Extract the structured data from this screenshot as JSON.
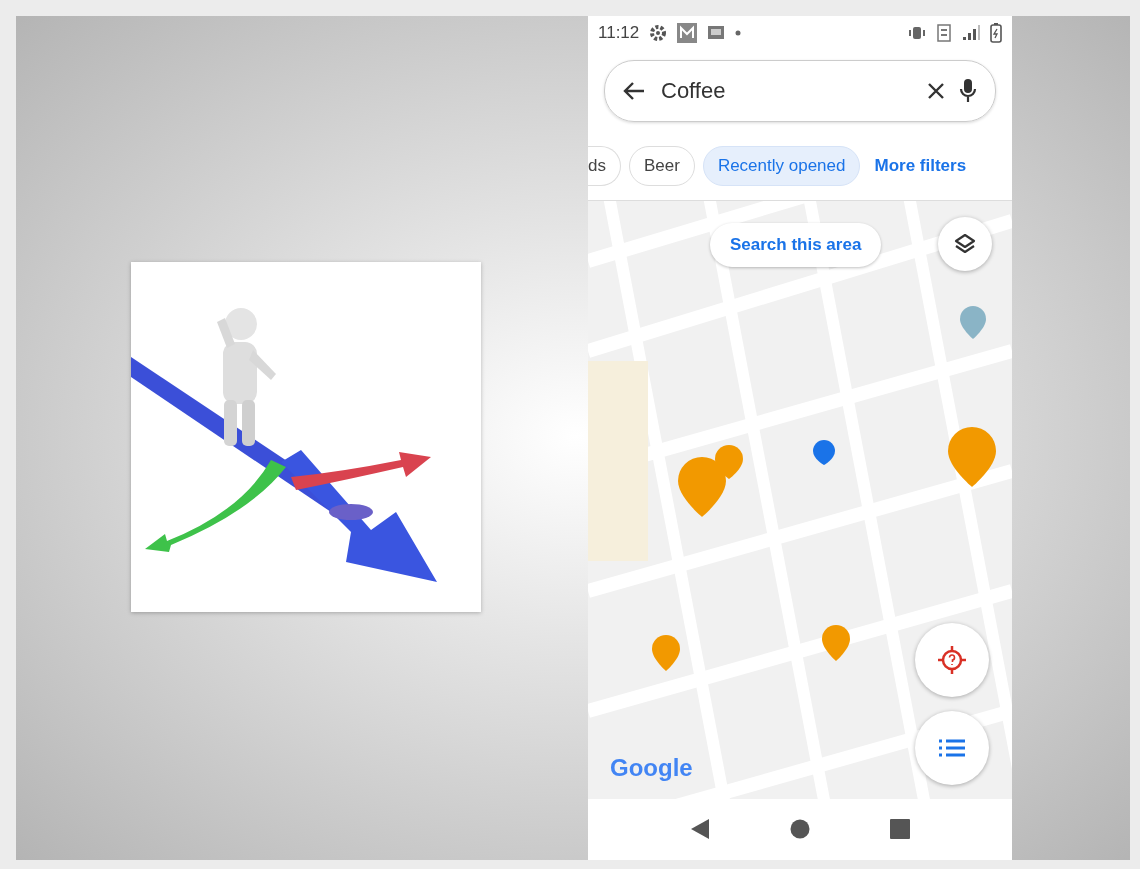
{
  "phone": {
    "status_bar": {
      "time": "11:12"
    },
    "search": {
      "value": "Coffee"
    },
    "filters": [
      {
        "label": "ds",
        "selected": false
      },
      {
        "label": "Beer",
        "selected": false
      },
      {
        "label": "Recently opened",
        "selected": true
      }
    ],
    "more_filters": "More filters",
    "map": {
      "kind": "picture",
      "search_area_button": "Search this area",
      "logo": "Google"
    }
  }
}
